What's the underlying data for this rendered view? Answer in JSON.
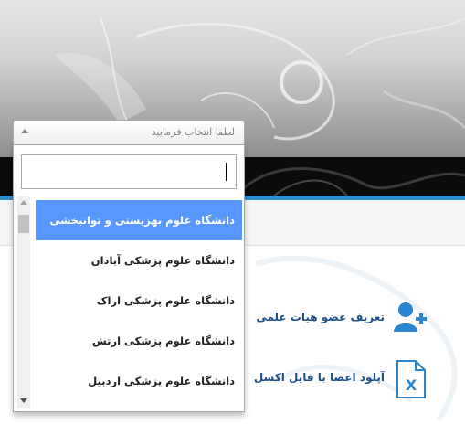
{
  "select": {
    "placeholder": "لطفا انتخاب فرمایید",
    "search_value": "",
    "options": [
      {
        "label": "دانشگاه علوم بهزیستی و توانبخشی",
        "selected": true
      },
      {
        "label": "دانشگاه علوم پزشکی آبادان",
        "selected": false
      },
      {
        "label": "دانشگاه علوم پزشکی اراک",
        "selected": false
      },
      {
        "label": "دانشگاه علوم پزشکی ارتش",
        "selected": false
      },
      {
        "label": "دانشگاه علوم پزشکی اردبیل",
        "selected": false
      }
    ]
  },
  "menu": {
    "items": [
      {
        "label": "تعریف عضو هیات علمی",
        "icon": "add-user-icon"
      },
      {
        "label": "آپلود اعضا با فایل اکسل",
        "icon": "excel-file-icon"
      }
    ]
  },
  "colors": {
    "selected_option": "#5897fb",
    "accent_line": "#2e8fd0",
    "menu_text": "#1f4f8a",
    "icon_blue": "#2a86d0"
  }
}
